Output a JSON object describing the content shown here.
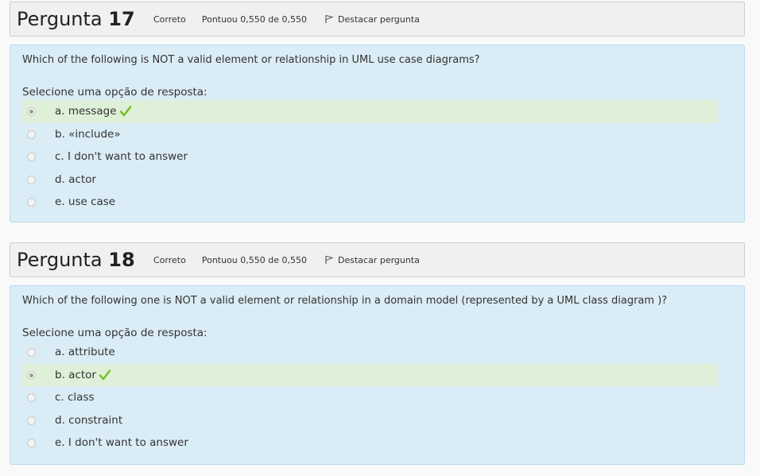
{
  "questions": [
    {
      "title_word": "Pergunta",
      "number": "17",
      "state": "Correto",
      "grade": "Pontuou 0,550 de 0,550",
      "flag_label": "Destacar pergunta",
      "text": "Which of the following is NOT a valid element or relationship in UML use case diagrams?",
      "prompt": "Selecione uma opção de resposta:",
      "options": [
        {
          "label": "a. message",
          "selected": true,
          "correct": true
        },
        {
          "label": "b. «include»",
          "selected": false,
          "correct": false
        },
        {
          "label": "c. I don't want to answer",
          "selected": false,
          "correct": false
        },
        {
          "label": "d. actor",
          "selected": false,
          "correct": false
        },
        {
          "label": "e. use case",
          "selected": false,
          "correct": false
        }
      ]
    },
    {
      "title_word": "Pergunta",
      "number": "18",
      "state": "Correto",
      "grade": "Pontuou 0,550 de 0,550",
      "flag_label": "Destacar pergunta",
      "text": "Which of the following one is NOT a valid element or relationship in a domain model (represented by a UML class diagram )?",
      "prompt": "Selecione uma opção de resposta:",
      "options": [
        {
          "label": "a. attribute",
          "selected": false,
          "correct": false
        },
        {
          "label": "b. actor",
          "selected": true,
          "correct": true
        },
        {
          "label": "c. class",
          "selected": false,
          "correct": false
        },
        {
          "label": "d. constraint",
          "selected": false,
          "correct": false
        },
        {
          "label": "e. I don't want to answer",
          "selected": false,
          "correct": false
        }
      ]
    }
  ],
  "colors": {
    "correct_highlight": "#dff0d8",
    "content_bg": "#daecf5",
    "tick": "#7bbf2a"
  },
  "icons": {
    "flag": "flag-icon",
    "tick": "check-icon"
  }
}
